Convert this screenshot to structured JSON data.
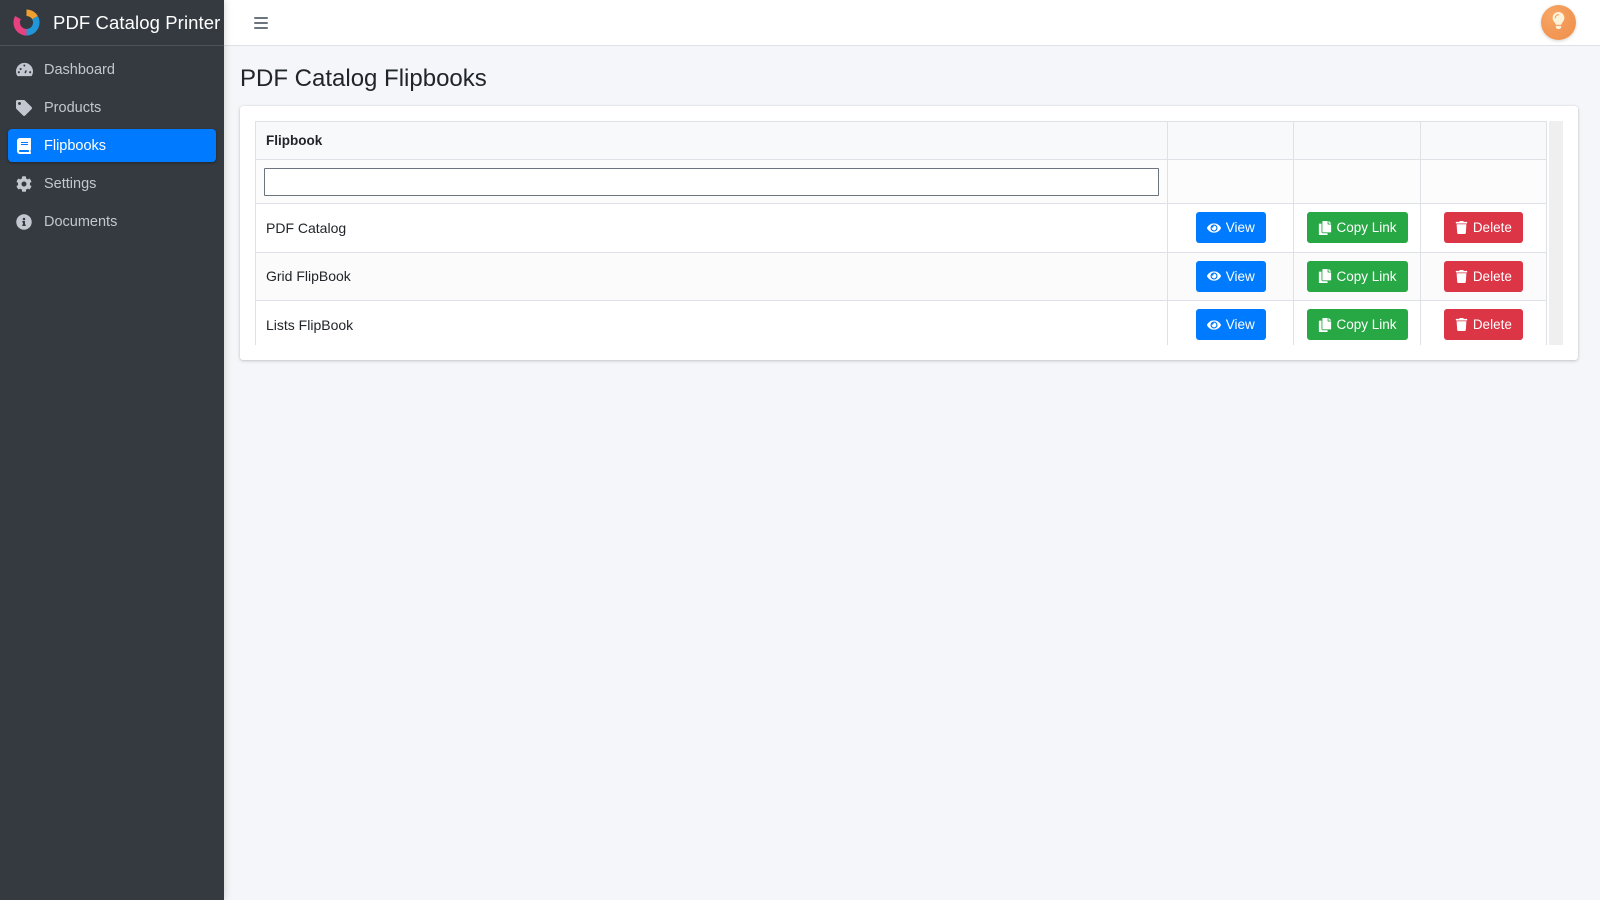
{
  "brand": {
    "title": "PDF Catalog Printer",
    "logo_icon": "tri-color-circle-logo"
  },
  "sidebar": {
    "items": [
      {
        "label": "Dashboard",
        "icon": "tachometer-icon",
        "active": false
      },
      {
        "label": "Products",
        "icon": "tag-icon",
        "active": false
      },
      {
        "label": "Flipbooks",
        "icon": "book-icon",
        "active": true
      },
      {
        "label": "Settings",
        "icon": "gear-icon",
        "active": false
      },
      {
        "label": "Documents",
        "icon": "info-circle-icon",
        "active": false
      }
    ],
    "active_color": "#007bff",
    "background": "#343a40"
  },
  "topbar": {
    "menu_icon": "hamburger-icon",
    "help_icon": "lightbulb-icon",
    "help_color": "#f39a58"
  },
  "page": {
    "title": "PDF Catalog Flipbooks"
  },
  "table": {
    "columns": [
      "Flipbook",
      "",
      "",
      ""
    ],
    "filter": {
      "value": "",
      "placeholder": ""
    },
    "rows": [
      {
        "name": "PDF Catalog",
        "view": "View",
        "copy": "Copy Link",
        "delete": "Delete"
      },
      {
        "name": "Grid FlipBook",
        "view": "View",
        "copy": "Copy Link",
        "delete": "Delete"
      },
      {
        "name": "Lists FlipBook",
        "view": "View",
        "copy": "Copy Link",
        "delete": "Delete"
      }
    ],
    "button_colors": {
      "view": "#007bff",
      "copy": "#28a745",
      "delete": "#dc3545"
    }
  }
}
